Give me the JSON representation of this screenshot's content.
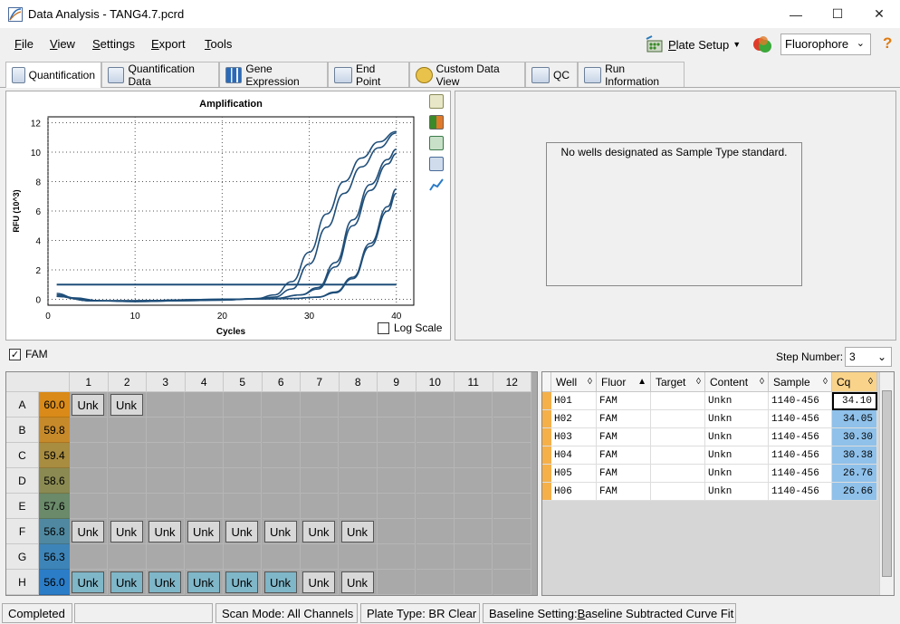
{
  "window": {
    "title": "Data Analysis - TANG4.7.pcrd",
    "controls": {
      "minimize": "—",
      "maximize": "☐",
      "close": "✕"
    }
  },
  "menu": {
    "items": [
      {
        "label": "File",
        "underline": "F",
        "rest": "ile"
      },
      {
        "label": "View",
        "underline": "V",
        "rest": "iew"
      },
      {
        "label": "Settings",
        "underline": "S",
        "rest": "ettings"
      },
      {
        "label": "Export",
        "underline": "E",
        "rest": "xport"
      },
      {
        "label": "Tools",
        "underline": "T",
        "rest": "ools"
      }
    ],
    "plate_setup": {
      "underline": "P",
      "rest": "late Setup"
    },
    "fluorophore": "Fluorophore",
    "help": "?"
  },
  "tabs": [
    {
      "label": "Quantification",
      "active": true
    },
    {
      "label": "Quantification Data"
    },
    {
      "label": "Gene Expression"
    },
    {
      "label": "End Point"
    },
    {
      "label": "Custom Data View"
    },
    {
      "label": "QC"
    },
    {
      "label": "Run Information"
    }
  ],
  "chart_data": {
    "type": "line",
    "title": "Amplification",
    "xlabel": "Cycles",
    "ylabel": "RFU (10^3)",
    "xlim": [
      0,
      42
    ],
    "ylim": [
      -0.4,
      12.4
    ],
    "x_ticks": [
      "0",
      "10",
      "20",
      "30",
      "40"
    ],
    "y_ticks": [
      "0",
      "2",
      "4",
      "6",
      "8",
      "10",
      "12"
    ],
    "grid": "dotted",
    "threshold": 1.0,
    "series": [
      {
        "values": [
          [
            1,
            0.3
          ],
          [
            3,
            0.05
          ],
          [
            6,
            -0.1
          ],
          [
            10,
            -0.15
          ],
          [
            15,
            -0.1
          ],
          [
            20,
            -0.05
          ],
          [
            24,
            0.05
          ],
          [
            26,
            0.3
          ],
          [
            28,
            1.2
          ],
          [
            30,
            3.2
          ],
          [
            32,
            5.8
          ],
          [
            34,
            8.0
          ],
          [
            36,
            9.6
          ],
          [
            38,
            10.7
          ],
          [
            40,
            11.4
          ]
        ]
      },
      {
        "values": [
          [
            1,
            0.4
          ],
          [
            3,
            0.1
          ],
          [
            6,
            -0.1
          ],
          [
            10,
            -0.15
          ],
          [
            15,
            -0.1
          ],
          [
            20,
            -0.05
          ],
          [
            24,
            0.05
          ],
          [
            26,
            0.15
          ],
          [
            28,
            0.7
          ],
          [
            30,
            2.4
          ],
          [
            32,
            4.9
          ],
          [
            34,
            7.2
          ],
          [
            36,
            9.0
          ],
          [
            38,
            10.3
          ],
          [
            40,
            11.3
          ]
        ]
      },
      {
        "values": [
          [
            1,
            0.2
          ],
          [
            5,
            -0.1
          ],
          [
            10,
            -0.1
          ],
          [
            20,
            0.0
          ],
          [
            26,
            0.05
          ],
          [
            29,
            0.3
          ],
          [
            31,
            0.8
          ],
          [
            33,
            2.5
          ],
          [
            35,
            5.4
          ],
          [
            37,
            7.8
          ],
          [
            39,
            9.5
          ],
          [
            40,
            10.2
          ]
        ]
      },
      {
        "values": [
          [
            1,
            0.2
          ],
          [
            5,
            -0.1
          ],
          [
            10,
            -0.1
          ],
          [
            20,
            0.0
          ],
          [
            26,
            0.05
          ],
          [
            29,
            0.3
          ],
          [
            31,
            0.7
          ],
          [
            33,
            2.2
          ],
          [
            35,
            5.0
          ],
          [
            37,
            7.4
          ],
          [
            39,
            9.2
          ],
          [
            40,
            9.9
          ]
        ]
      },
      {
        "values": [
          [
            1,
            0.2
          ],
          [
            5,
            -0.1
          ],
          [
            10,
            -0.1
          ],
          [
            20,
            0.0
          ],
          [
            28,
            0.05
          ],
          [
            31,
            0.15
          ],
          [
            33,
            0.5
          ],
          [
            35,
            1.5
          ],
          [
            37,
            3.8
          ],
          [
            39,
            6.3
          ],
          [
            40,
            7.5
          ]
        ]
      },
      {
        "values": [
          [
            1,
            0.2
          ],
          [
            5,
            -0.1
          ],
          [
            10,
            -0.1
          ],
          [
            20,
            0.0
          ],
          [
            28,
            0.05
          ],
          [
            31,
            0.15
          ],
          [
            33,
            0.45
          ],
          [
            35,
            1.4
          ],
          [
            37,
            3.6
          ],
          [
            39,
            6.0
          ],
          [
            40,
            7.2
          ]
        ]
      }
    ]
  },
  "chart_extra": {
    "log_scale": "Log Scale"
  },
  "standard_panel": {
    "message": "No wells designated as Sample Type standard."
  },
  "fam": {
    "label": "FAM",
    "checked": true
  },
  "step_number": {
    "label": "Step Number:",
    "value": "3"
  },
  "plate": {
    "columns": [
      "1",
      "2",
      "3",
      "4",
      "5",
      "6",
      "7",
      "8",
      "9",
      "10",
      "11",
      "12"
    ],
    "rows": [
      {
        "row": "A",
        "temp": "60.0",
        "color": "#d98a18",
        "wells": [
          [
            "Unk",
            "gray"
          ],
          [
            "Unk",
            "gray"
          ]
        ]
      },
      {
        "row": "B",
        "temp": "59.8",
        "color": "#c78a2a",
        "wells": []
      },
      {
        "row": "C",
        "temp": "59.4",
        "color": "#a88c40",
        "wells": []
      },
      {
        "row": "D",
        "temp": "58.6",
        "color": "#8a8a52",
        "wells": []
      },
      {
        "row": "E",
        "temp": "57.6",
        "color": "#6a8a6a",
        "wells": []
      },
      {
        "row": "F",
        "temp": "56.8",
        "color": "#4f88a0",
        "wells": [
          [
            "Unk",
            "gray"
          ],
          [
            "Unk",
            "gray"
          ],
          [
            "Unk",
            "gray"
          ],
          [
            "Unk",
            "gray"
          ],
          [
            "Unk",
            "gray"
          ],
          [
            "Unk",
            "gray"
          ],
          [
            "Unk",
            "gray"
          ],
          [
            "Unk",
            "gray"
          ]
        ]
      },
      {
        "row": "G",
        "temp": "56.3",
        "color": "#3d84b8",
        "wells": []
      },
      {
        "row": "H",
        "temp": "56.0",
        "color": "#2b7dc8",
        "wells": [
          [
            "Unk",
            "blue"
          ],
          [
            "Unk",
            "blue"
          ],
          [
            "Unk",
            "blue"
          ],
          [
            "Unk",
            "blue"
          ],
          [
            "Unk",
            "blue"
          ],
          [
            "Unk",
            "blue"
          ],
          [
            "Unk",
            "gray"
          ],
          [
            "Unk",
            "gray"
          ]
        ]
      }
    ]
  },
  "grid": {
    "headers": [
      "Well",
      "Fluor",
      "Target",
      "Content",
      "Sample",
      "Cq"
    ],
    "rows": [
      [
        "H01",
        "FAM",
        "",
        "Unkn",
        "1140-456",
        "34.10"
      ],
      [
        "H02",
        "FAM",
        "",
        "Unkn",
        "1140-456",
        "34.05"
      ],
      [
        "H03",
        "FAM",
        "",
        "Unkn",
        "1140-456",
        "30.30"
      ],
      [
        "H04",
        "FAM",
        "",
        "Unkn",
        "1140-456",
        "30.38"
      ],
      [
        "H05",
        "FAM",
        "",
        "Unkn",
        "1140-456",
        "26.76"
      ],
      [
        "H06",
        "FAM",
        "",
        "Unkn",
        "1140-456",
        "26.66"
      ]
    ]
  },
  "status": {
    "state": "Completed",
    "scan_mode": "Scan Mode: All Channels",
    "plate_type": "Plate Type: BR Clear",
    "baseline_prefix": "Baseline Setting: ",
    "baseline_underline": "B",
    "baseline_rest": "aseline Subtracted Curve Fit"
  },
  "colors": {
    "curve": "#1f4e79",
    "threshold": "#1f4e79",
    "cq_cell": "#8fc1ea",
    "accent_orange": "#f5b04a"
  }
}
